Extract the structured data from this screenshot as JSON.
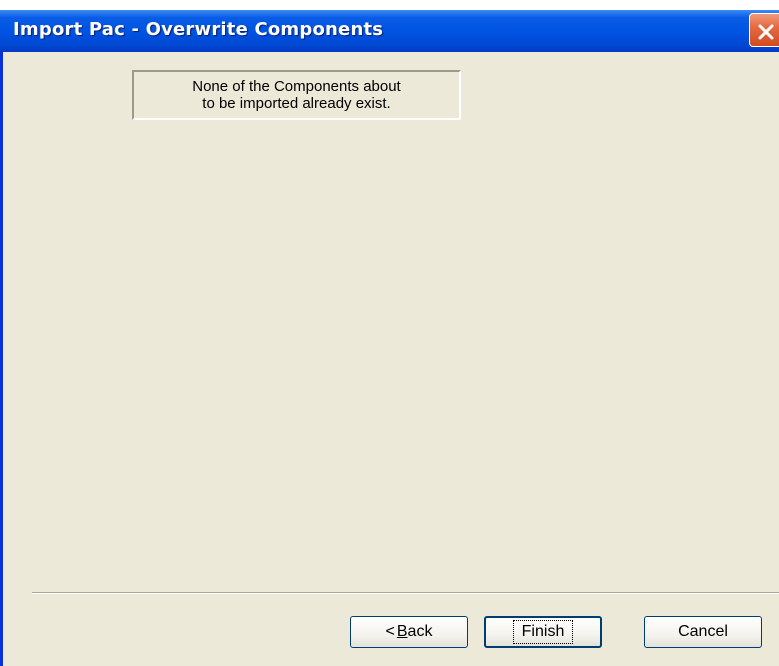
{
  "window": {
    "title": "Import Pac - Overwrite Components"
  },
  "message": {
    "line1": "None of the Components about",
    "line2": "to be imported already exist."
  },
  "buttons": {
    "back_arrow": "<",
    "back_mnemonic": "B",
    "back_rest": "ack",
    "finish": "Finish",
    "cancel": "Cancel"
  },
  "icons": {
    "close": "close-icon"
  },
  "colors": {
    "titlebar": "#0054e3",
    "close": "#e56a42",
    "dialog_bg": "#ece9d8"
  }
}
